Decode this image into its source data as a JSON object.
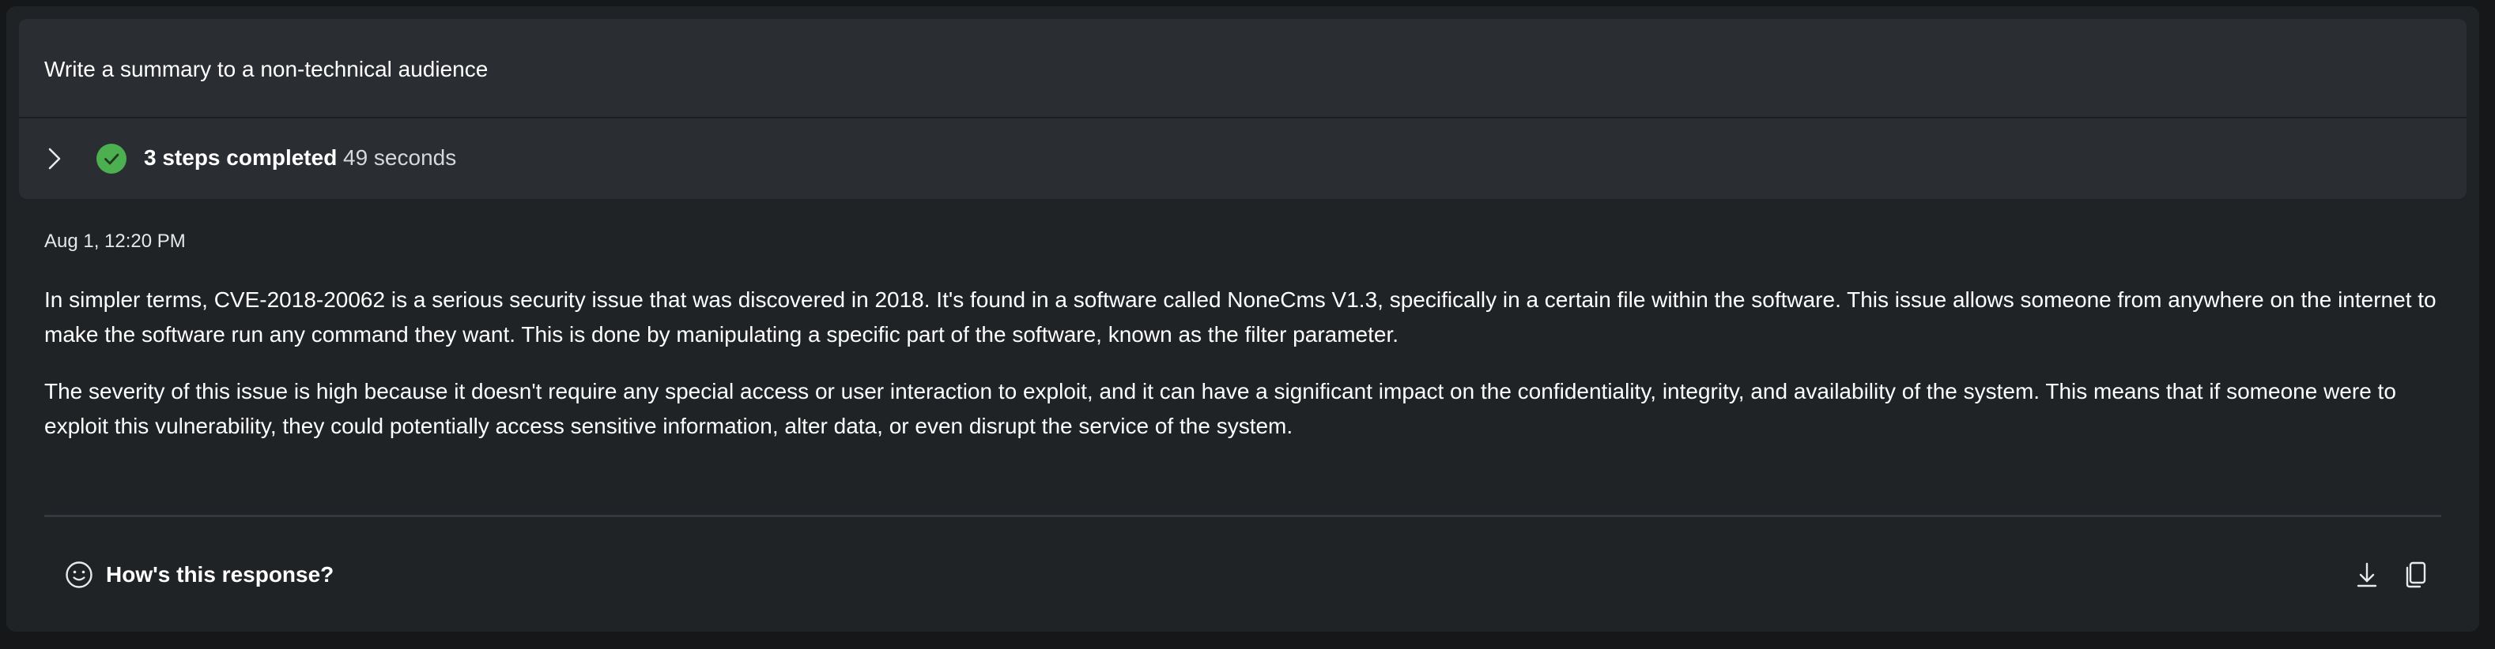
{
  "prompt": {
    "text": "Write a summary to a non-technical audience"
  },
  "steps": {
    "status_label": "3 steps completed",
    "duration": "49 seconds",
    "expand_icon": "chevron-right-icon",
    "status_icon": "check-circle-icon",
    "status_color": "#4caf50"
  },
  "response": {
    "timestamp": "Aug 1, 12:20 PM",
    "paragraphs": [
      "In simpler terms, CVE-2018-20062 is a serious security issue that was discovered in 2018. It's found in a software called NoneCms V1.3, specifically in a certain file within the software. This issue allows someone from anywhere on the internet to make the software run any command they want. This is done by manipulating a specific part of the software, known as the filter parameter.",
      "The severity of this issue is high because it doesn't require any special access or user interaction to exploit, and it can have a significant impact on the confidentiality, integrity, and availability of the system. This means that if someone were to exploit this vulnerability, they could potentially access sensitive information, alter data, or even disrupt the service of the system."
    ]
  },
  "footer": {
    "feedback_label": "How's this response?",
    "feedback_icon": "smile-face-icon",
    "download_icon": "download-icon",
    "copy_icon": "copy-icon"
  },
  "colors": {
    "page_background": "#161718",
    "card_background": "#202326",
    "prompt_background": "#2a2d31",
    "text": "#ffffff"
  }
}
